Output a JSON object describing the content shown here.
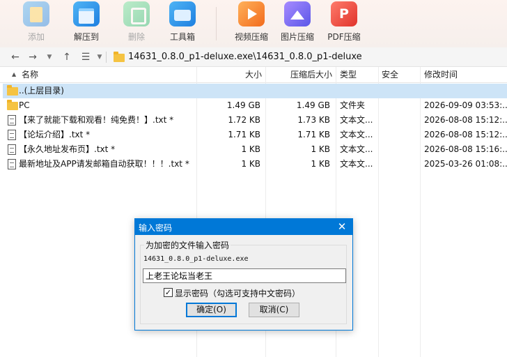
{
  "toolbar": {
    "add": "添加",
    "extract": "解压到",
    "delete": "删除",
    "tools": "工具箱",
    "video": "视频压缩",
    "image": "图片压缩",
    "pdf": "PDF压缩"
  },
  "address": {
    "path": "14631_0.8.0_p1-deluxe.exe\\14631_0.8.0_p1-deluxe"
  },
  "columns": {
    "name": "名称",
    "size": "大小",
    "packed": "压缩后大小",
    "type": "类型",
    "security": "安全",
    "modified": "修改时间"
  },
  "rows": [
    {
      "name": "..(上层目录)",
      "size": "",
      "packed": "",
      "type": "",
      "modified": ""
    },
    {
      "name": "PC",
      "size": "1.49 GB",
      "packed": "1.49 GB",
      "type": "文件夹",
      "modified": "2026-09-09 03:53:..."
    },
    {
      "name": "【来了就能下载和观看！纯免费！】.txt *",
      "size": "1.72 KB",
      "packed": "1.73 KB",
      "type": "文本文...",
      "modified": "2026-08-08 15:12:..."
    },
    {
      "name": "【论坛介绍】.txt *",
      "size": "1.71 KB",
      "packed": "1.71 KB",
      "type": "文本文...",
      "modified": "2026-08-08 15:12:..."
    },
    {
      "name": "【永久地址发布页】.txt *",
      "size": "1 KB",
      "packed": "1 KB",
      "type": "文本文...",
      "modified": "2026-08-08 15:16:..."
    },
    {
      "name": "最新地址及APP请发邮箱自动获取！！！.txt *",
      "size": "1 KB",
      "packed": "1 KB",
      "type": "文本文...",
      "modified": "2025-03-26 01:08:..."
    }
  ],
  "dialog": {
    "title": "输入密码",
    "group_label": "为加密的文件输入密码",
    "filename": "14631_0.8.0_p1-deluxe.exe",
    "password": "上老王论坛当老王",
    "show_password": "显示密码（勾选可支持中文密码）",
    "ok": "确定(O)",
    "cancel": "取消(C)"
  },
  "icons": {
    "sort": "▲",
    "close": "✕",
    "check": "✓"
  }
}
